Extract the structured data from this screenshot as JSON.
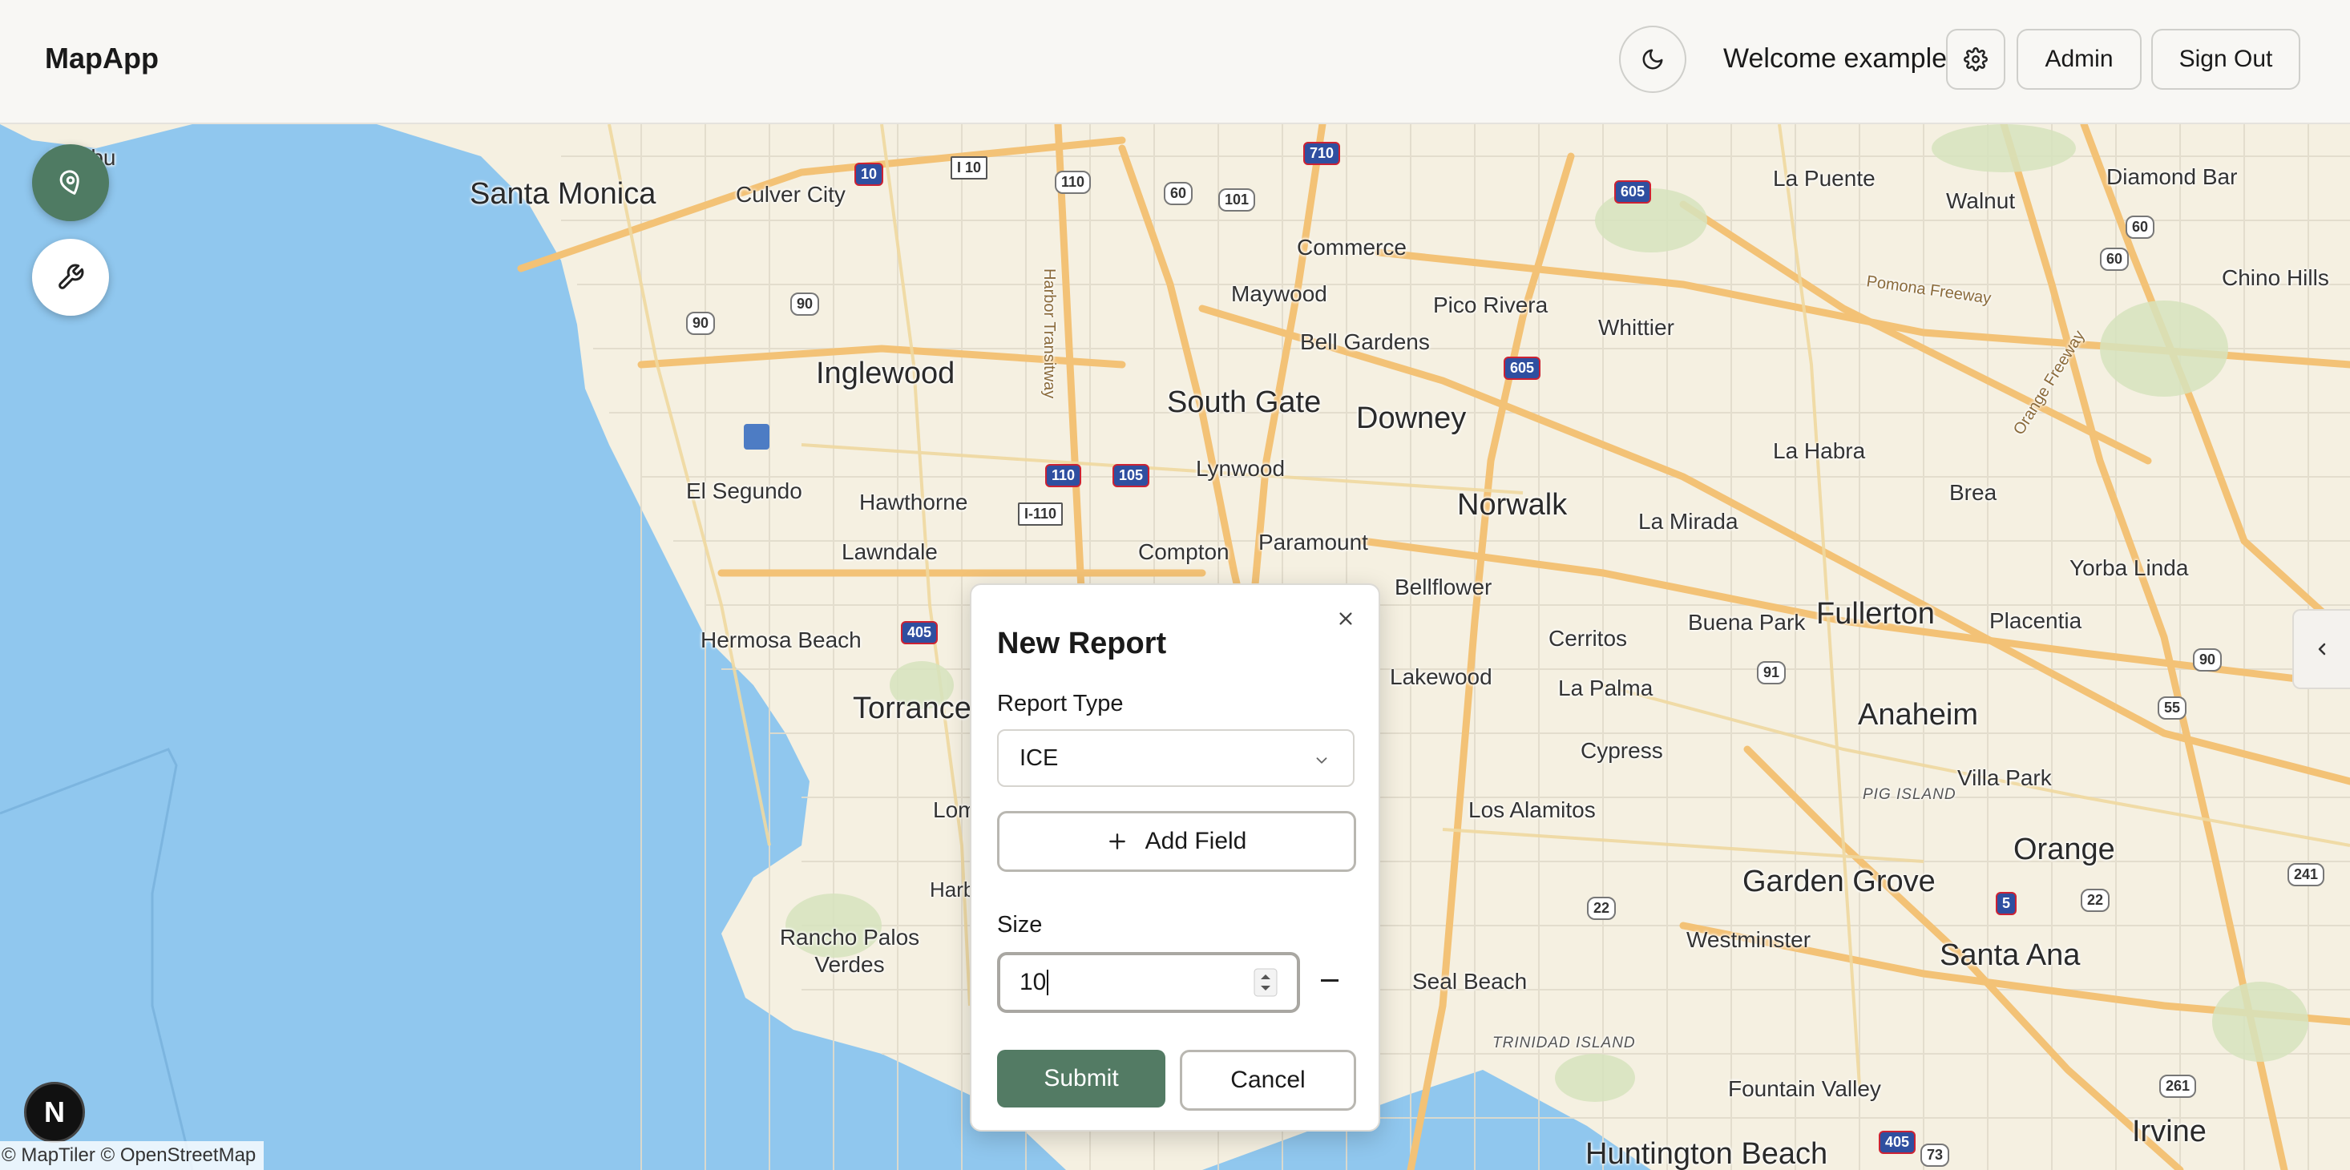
{
  "app": {
    "title": "MapApp"
  },
  "header": {
    "theme_toggle_icon": "moon-icon",
    "welcome_text": "Welcome example",
    "settings_icon": "gear-icon",
    "admin_label": "Admin",
    "signout_label": "Sign Out"
  },
  "map": {
    "attribution": "© MapTiler © OpenStreetMap",
    "places": [
      {
        "name": "Santa Monica",
        "size": "l"
      },
      {
        "name": "Culver City",
        "size": "m"
      },
      {
        "name": "Inglewood",
        "size": "l"
      },
      {
        "name": "South Gate",
        "size": "l"
      },
      {
        "name": "Downey",
        "size": "l"
      },
      {
        "name": "Norwalk",
        "size": "l"
      },
      {
        "name": "Fullerton",
        "size": "l"
      },
      {
        "name": "Anaheim",
        "size": "l"
      },
      {
        "name": "Orange",
        "size": "l"
      },
      {
        "name": "Garden Grove",
        "size": "l"
      },
      {
        "name": "Santa Ana",
        "size": "l"
      },
      {
        "name": "Irvine",
        "size": "l"
      },
      {
        "name": "Huntington Beach",
        "size": "l"
      },
      {
        "name": "Torrance",
        "size": "l"
      },
      {
        "name": "Commerce",
        "size": "m"
      },
      {
        "name": "Maywood",
        "size": "m"
      },
      {
        "name": "Bell Gardens",
        "size": "m"
      },
      {
        "name": "Pico Rivera",
        "size": "m"
      },
      {
        "name": "Whittier",
        "size": "m"
      },
      {
        "name": "La Puente",
        "size": "m"
      },
      {
        "name": "Walnut",
        "size": "m"
      },
      {
        "name": "Diamond Bar",
        "size": "m"
      },
      {
        "name": "Chino Hills",
        "size": "m"
      },
      {
        "name": "La Habra",
        "size": "m"
      },
      {
        "name": "Brea",
        "size": "m"
      },
      {
        "name": "La Mirada",
        "size": "m"
      },
      {
        "name": "Yorba Linda",
        "size": "m"
      },
      {
        "name": "Buena Park",
        "size": "m"
      },
      {
        "name": "Placentia",
        "size": "m"
      },
      {
        "name": "Cerritos",
        "size": "m"
      },
      {
        "name": "La Palma",
        "size": "m"
      },
      {
        "name": "Cypress",
        "size": "m"
      },
      {
        "name": "Villa Park",
        "size": "m"
      },
      {
        "name": "Los Alamitos",
        "size": "m"
      },
      {
        "name": "Lakewood",
        "size": "m"
      },
      {
        "name": "Bellflower",
        "size": "m"
      },
      {
        "name": "Paramount",
        "size": "m"
      },
      {
        "name": "Lynwood",
        "size": "m"
      },
      {
        "name": "Compton",
        "size": "m"
      },
      {
        "name": "Hawthorne",
        "size": "m"
      },
      {
        "name": "Lawndale",
        "size": "m"
      },
      {
        "name": "El Segundo",
        "size": "m"
      },
      {
        "name": "Hermosa Beach",
        "size": "m"
      },
      {
        "name": "Rancho Palos Verdes",
        "size": "m"
      },
      {
        "name": "Seal Beach",
        "size": "m"
      },
      {
        "name": "Westminster",
        "size": "m"
      },
      {
        "name": "Fountain Valley",
        "size": "m"
      },
      {
        "name": "Malibu",
        "size": "m"
      },
      {
        "name": "Lom",
        "size": "m"
      },
      {
        "name": "Harb",
        "size": "s"
      },
      {
        "name": "TRINIDAD ISLAND",
        "size": "it"
      },
      {
        "name": "PIG ISLAND",
        "size": "it"
      },
      {
        "name": "Harbor Transitway",
        "size": "road"
      },
      {
        "name": "Pomona Freeway",
        "size": "road"
      },
      {
        "name": "Orange Freeway",
        "size": "road"
      }
    ],
    "shields": [
      "10",
      "I 10",
      "110",
      "60",
      "101",
      "710",
      "605",
      "60",
      "60",
      "90",
      "90",
      "110",
      "105",
      "I-110",
      "405",
      "605",
      "91",
      "90",
      "55",
      "22",
      "5",
      "22",
      "241",
      "261",
      "405",
      "73"
    ],
    "left_tools": [
      "location-target-icon",
      "wrench-icon"
    ],
    "side_toggle_icon": "chevron-left-icon",
    "pin_icon": "map-pin-icon",
    "badge_letter": "N"
  },
  "dialog": {
    "title": "New Report",
    "report_type_label": "Report Type",
    "report_type_value": "ICE",
    "add_field_label": "Add Field",
    "size_label": "Size",
    "size_value": "10",
    "submit_label": "Submit",
    "cancel_label": "Cancel",
    "close_icon": "close-icon"
  },
  "colors": {
    "accent": "#537b64",
    "water": "#90c7ee",
    "land": "#f5f0e1"
  }
}
